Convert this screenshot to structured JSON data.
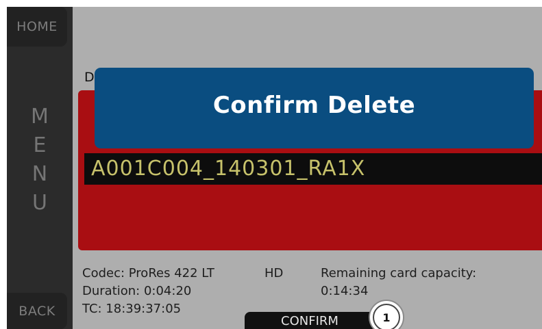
{
  "sidebar": {
    "home_label": "HOME",
    "menu_letters": [
      "M",
      "E",
      "N",
      "U"
    ],
    "back_label": "BACK"
  },
  "clip": {
    "header_fragment": "D",
    "name": "A001C004_140301_RA1X"
  },
  "dialog": {
    "title": "Confirm Delete"
  },
  "info": {
    "codec": "Codec: ProRes 422 LT",
    "resolution": "HD",
    "duration": "Duration: 0:04:20",
    "tc": "TC: 18:39:37:05",
    "remaining_label": "Remaining card capacity:",
    "remaining_value": "0:14:34"
  },
  "actions": {
    "confirm_label": "CONFIRM"
  },
  "callout": {
    "number": "1"
  },
  "colors": {
    "dialog_blue": "#0a4d80",
    "panel_red": "#a90e12",
    "clip_text": "#c7c26b",
    "screen_gray": "#aeaeae"
  }
}
